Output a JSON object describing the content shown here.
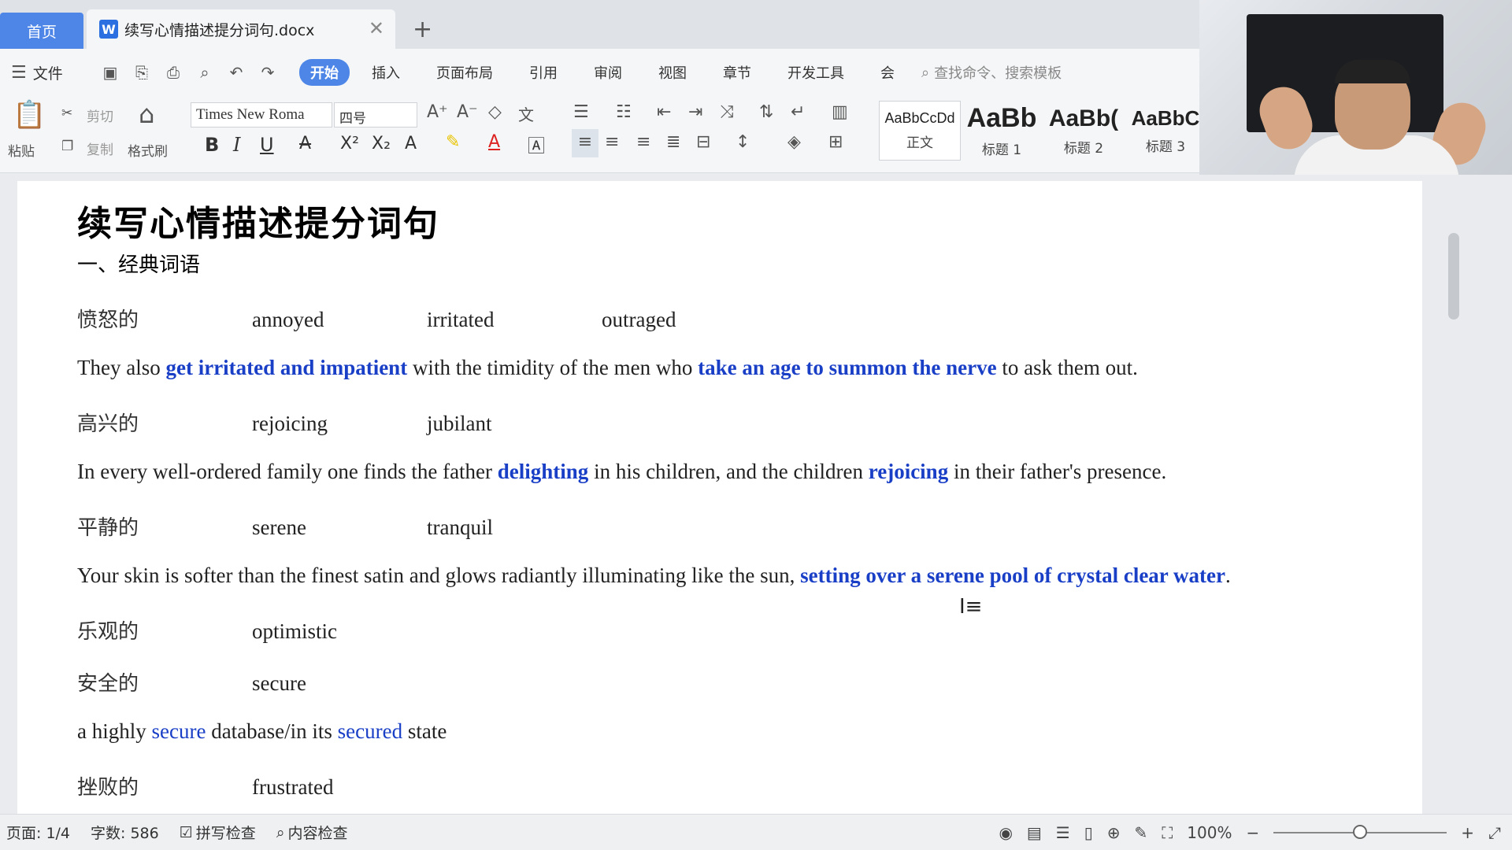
{
  "tabs": {
    "home": "首页",
    "doc": "续写心情描述提分词句.docx",
    "close": "✕",
    "add": "+"
  },
  "menu": {
    "file": "文件",
    "items": [
      "开始",
      "插入",
      "页面布局",
      "引用",
      "审阅",
      "视图",
      "章节",
      "开发工具"
    ],
    "more": "会",
    "search_placeholder": "查找命令、搜索模板"
  },
  "ribbon": {
    "paste": "粘贴",
    "cut": "剪切",
    "copy": "复制",
    "format_painter": "格式刷",
    "font": "Times New Roma",
    "size": "四号",
    "styles": [
      {
        "preview": "AaBbCcDd",
        "name": "正文"
      },
      {
        "preview": "AaBb",
        "name": "标题 1"
      },
      {
        "preview": "AaBb(",
        "name": "标题 2"
      },
      {
        "preview": "AaBbC",
        "name": "标题 3"
      }
    ]
  },
  "document": {
    "title": "续写心情描述提分词句",
    "section": "一、经典词语",
    "rows": [
      {
        "zh": "愤怒的",
        "w1": "annoyed",
        "w2": "irritated",
        "w3": "outraged"
      },
      {
        "zh": "高兴的",
        "w1": "rejoicing",
        "w2": "jubilant"
      },
      {
        "zh": "平静的",
        "w1": "serene",
        "w2": "tranquil"
      },
      {
        "zh": "乐观的",
        "w1": "optimistic"
      },
      {
        "zh": "安全的",
        "w1": "secure"
      },
      {
        "zh": "挫败的",
        "w1": "frustrated"
      }
    ],
    "s1": {
      "a": "They also ",
      "b": "get irritated and impatient",
      "c": " with the timidity of the men who ",
      "d": "take an age to summon the nerve",
      "e": " to ask them out."
    },
    "s2": {
      "a": "In every well-ordered family one finds the father ",
      "b": "delighting",
      "c": " in his children, and the children ",
      "d": "rejoicing",
      "e": " in their father's presence."
    },
    "s3": {
      "a": "Your skin is softer than the finest satin and glows radiantly illuminating like the sun, ",
      "b": "setting over a serene pool of crystal clear water",
      "c": "."
    },
    "s4": {
      "a": "a highly ",
      "b": "secure",
      "c": " database/in its ",
      "d": "secured",
      "e": " state"
    }
  },
  "status": {
    "page": "页面: 1/4",
    "words": "字数: 586",
    "spell": "拼写检查",
    "content": "内容检查",
    "zoom": "100%",
    "zoom_fraction": 0.5
  },
  "colors": {
    "accent": "#4e86e8",
    "highlight": "#1a3fc7"
  }
}
